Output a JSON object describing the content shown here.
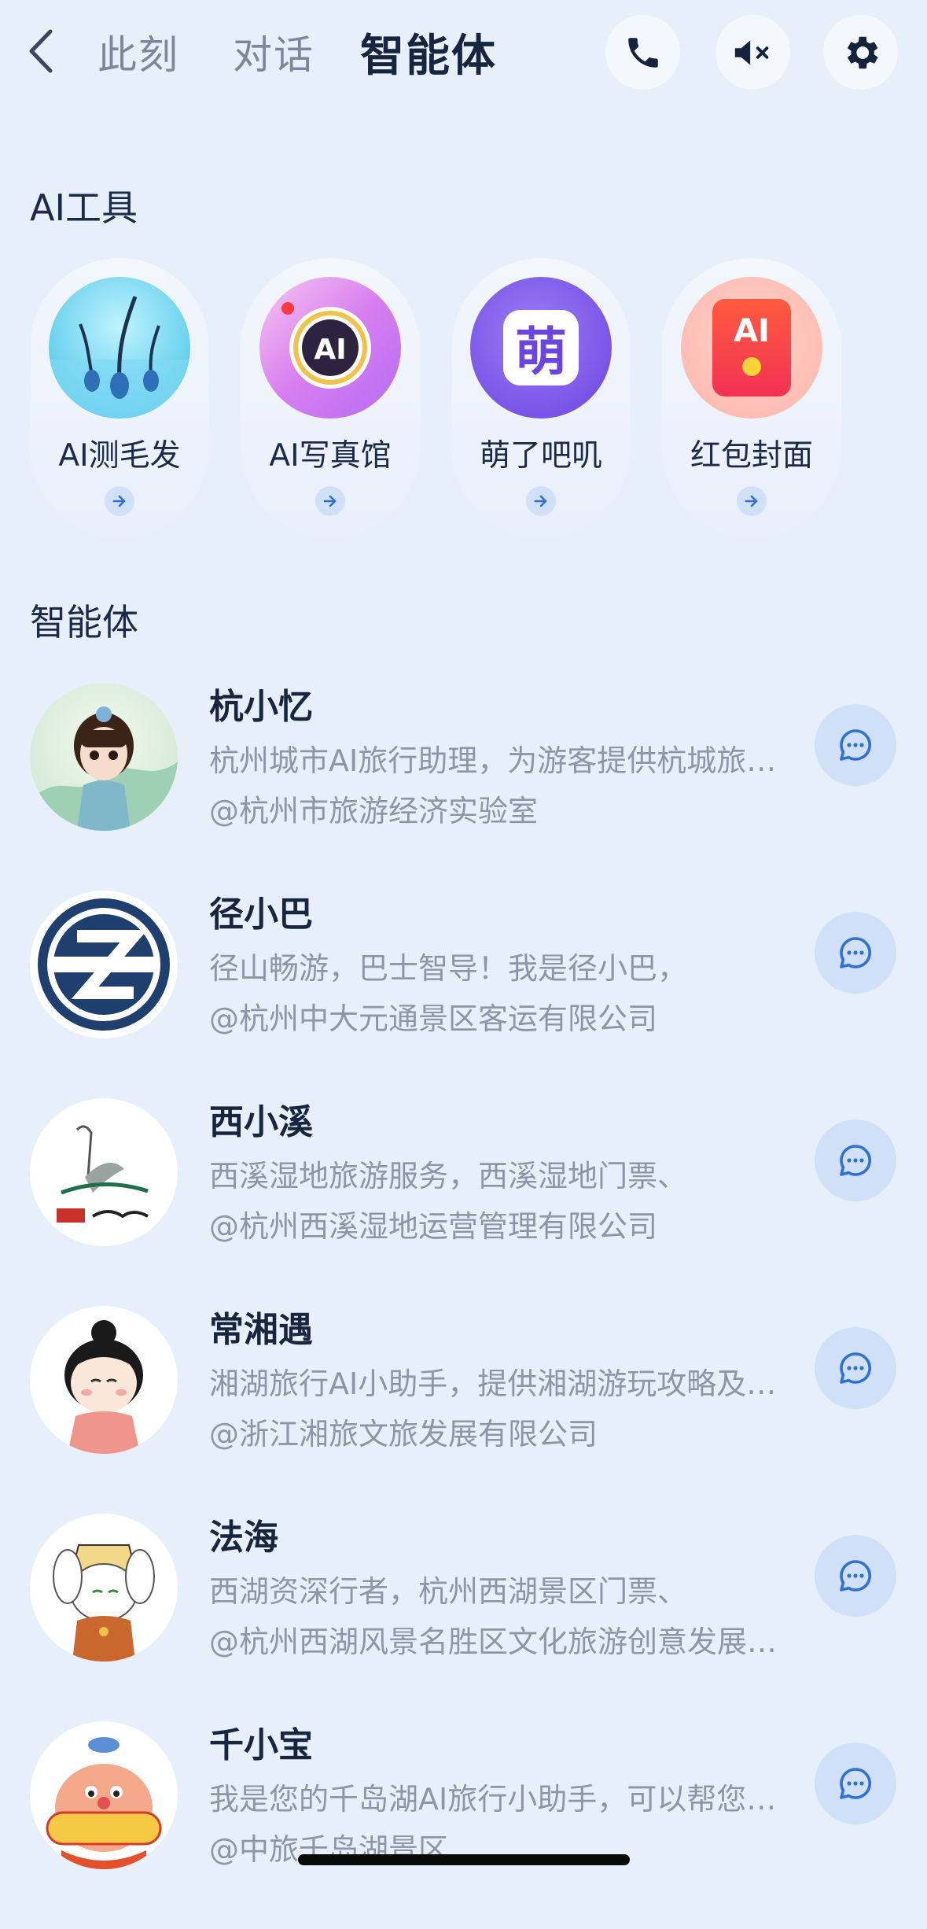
{
  "header": {
    "tabs": [
      {
        "label": "此刻",
        "active": false
      },
      {
        "label": "对话",
        "active": false
      },
      {
        "label": "智能体",
        "active": true
      }
    ],
    "icons": [
      "back-icon",
      "phone-icon",
      "mute-icon",
      "gear-icon"
    ]
  },
  "tools_section": {
    "title": "AI工具",
    "items": [
      {
        "label": "AI测毛发",
        "icon": "hair-icon"
      },
      {
        "label": "AI写真馆",
        "icon": "camera-lens-icon"
      },
      {
        "label": "萌了吧叽",
        "icon": "cute-icon",
        "icon_text": "萌"
      },
      {
        "label": "红包封面",
        "icon": "red-envelope-icon",
        "icon_text": "AI"
      }
    ]
  },
  "agents_section": {
    "title": "智能体",
    "items": [
      {
        "name": "杭小忆",
        "desc": "杭州城市AI旅行助理，为游客提供杭城旅行服务",
        "org": "@杭州市旅游经济实验室"
      },
      {
        "name": "径小巴",
        "desc": "径山畅游，巴士智导！我是径小巴，",
        "org": "@杭州中大元通景区客运有限公司"
      },
      {
        "name": "西小溪",
        "desc": "西溪湿地旅游服务，西溪湿地门票、",
        "org": "@杭州西溪湿地运营管理有限公司"
      },
      {
        "name": "常湘遇",
        "desc": "湘湖旅行AI小助手，提供湘湖游玩攻略及服务",
        "org": "@浙江湘旅文旅发展有限公司"
      },
      {
        "name": "法海",
        "desc": "西湖资深行者，杭州西湖景区门票、",
        "org": "@杭州西湖风景名胜区文化旅游创意发展有限公司"
      },
      {
        "name": "千小宝",
        "desc": "我是您的千岛湖AI旅行小助手，可以帮您规划行程",
        "org": "@中旅千岛湖景区"
      }
    ]
  },
  "colors": {
    "background": "#e7effb",
    "accent": "#2f6fd6",
    "chip": "#cfe0f8"
  }
}
